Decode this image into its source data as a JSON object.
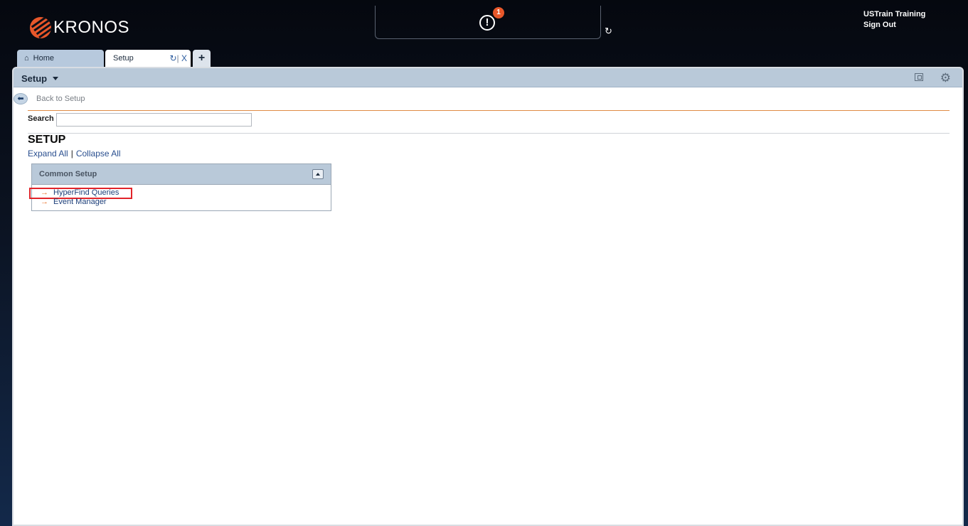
{
  "header": {
    "logo_text": "KRONOS",
    "alert_count": "1",
    "user_name": "USTrain Training",
    "sign_out": "Sign Out"
  },
  "tabs": [
    {
      "label": "Home",
      "icon": "home-icon"
    },
    {
      "label": "Setup",
      "icon": "refresh-icon",
      "close": "X"
    },
    {
      "label": "+"
    }
  ],
  "panel": {
    "title": "Setup",
    "back_label": "Back to Setup",
    "search_label": "Search",
    "search_value": "",
    "heading": "SETUP",
    "expand_all": "Expand All",
    "separator": "|",
    "collapse_all": "Collapse All",
    "section": {
      "title": "Common Setup",
      "items": [
        {
          "label": "HyperFind Queries",
          "highlighted": true
        },
        {
          "label": "Event Manager",
          "highlighted": false
        }
      ]
    }
  },
  "colors": {
    "accent_orange": "#e8572a",
    "panel_bar": "#b9c9d9",
    "link_blue": "#2a4f8f",
    "highlight_red": "#e1242a"
  }
}
